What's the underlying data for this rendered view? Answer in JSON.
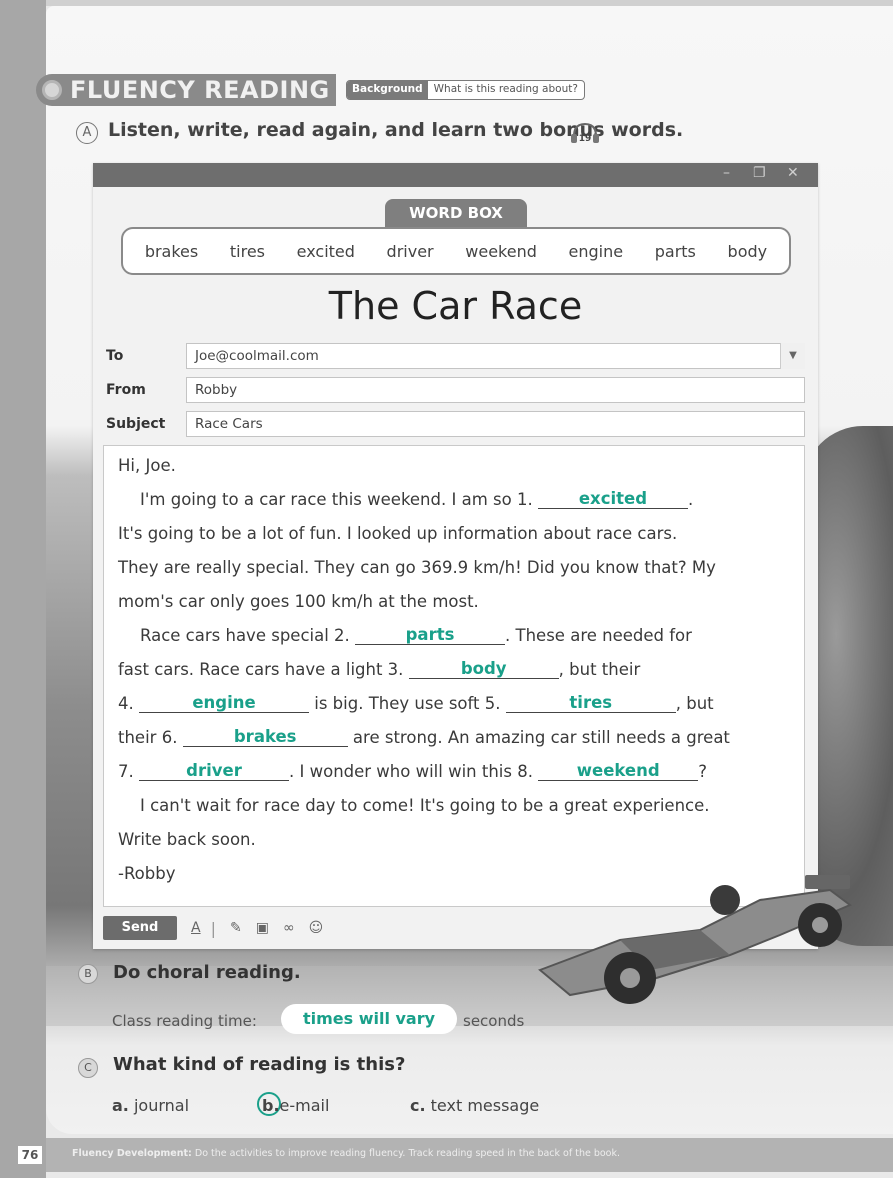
{
  "header": {
    "section_title": "FLUENCY READING",
    "badge": "Background",
    "badge_question": "What is this reading about?"
  },
  "section_a": {
    "letter": "A",
    "instruction": "Listen, write, read again, and learn two bonus words.",
    "audio_track": "19"
  },
  "word_box": {
    "label": "WORD BOX",
    "words": [
      "brakes",
      "tires",
      "excited",
      "driver",
      "weekend",
      "engine",
      "parts",
      "body"
    ]
  },
  "email": {
    "title": "The Car Race",
    "window_controls": [
      "–",
      "❐",
      "✕"
    ],
    "to_label": "To",
    "to_value": "Joe@coolmail.com",
    "from_label": "From",
    "from_value": "Robby",
    "subject_label": "Subject",
    "subject_value": "Race Cars",
    "body": {
      "greeting": "Hi, Joe.",
      "l1a": "I'm going to a car race this weekend. I am so 1. ",
      "b1": "excited",
      "l1b": ".",
      "l2": "It's going to be a lot of fun. I looked up information about race cars.",
      "l3": "They are really special. They can go 369.9 km/h! Did you know that? My",
      "l4": "mom's car only goes 100 km/h at the most.",
      "l5a": "Race cars have special 2. ",
      "b2": "parts",
      "l5b": ". These are needed for",
      "l6a": "fast cars. Race cars have a light 3. ",
      "b3": "body",
      "l6b": ", but their",
      "l7a": "4. ",
      "b4": "engine",
      "l7b": " is big. They use soft 5. ",
      "b5": "tires",
      "l7c": ", but",
      "l8a": "their 6. ",
      "b6": "brakes",
      "l8b": " are strong. An amazing car still needs a great",
      "l9a": "7. ",
      "b7": "driver",
      "l9b": ". I wonder who will win this 8. ",
      "b8": "weekend",
      "l9c": "?",
      "l10": "I can't wait for race day to come! It's going to be a great experience.",
      "l11": "Write back soon.",
      "l12": "-Robby"
    },
    "send_label": "Send"
  },
  "section_b": {
    "letter": "B",
    "instruction": "Do choral reading.",
    "time_label": "Class reading time:",
    "time_value": "times will vary",
    "time_unit": "seconds"
  },
  "section_c": {
    "letter": "C",
    "question": "What kind of reading is this?",
    "options": [
      {
        "letter": "a.",
        "text": "journal"
      },
      {
        "letter": "b.",
        "text": "e-mail"
      },
      {
        "letter": "c.",
        "text": "text message"
      }
    ],
    "selected": "b"
  },
  "footer": {
    "page_number": "76",
    "label": "Fluency Development:",
    "text": "Do the activities to improve reading fluency. Track reading speed in the back of the book."
  },
  "colors": {
    "answer": "#1aa08a",
    "header_bar": "#8a8a8a",
    "window_bar": "#6e6e6e"
  }
}
